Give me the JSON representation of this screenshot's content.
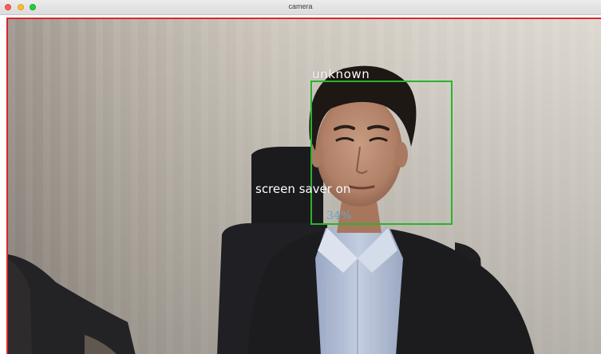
{
  "window": {
    "title": "camera"
  },
  "overlay": {
    "face_label": "unknown",
    "status_text": "screen saver on",
    "percent_text": "34%"
  },
  "colors": {
    "face_box": "#28b42c",
    "view_border": "#d9272b",
    "percent_text": "#5fa8c9",
    "label_text": "#ffffff"
  }
}
